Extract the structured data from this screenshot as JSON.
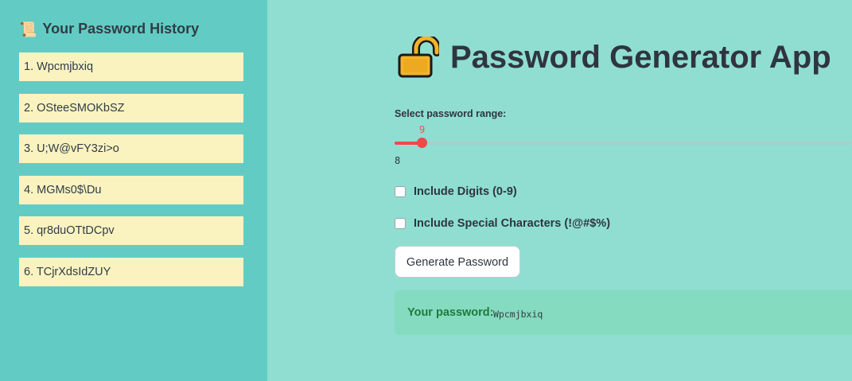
{
  "sidebar": {
    "title": "Your Password History",
    "title_icon": "scroll-icon",
    "history": [
      "1. Wpcmjbxiq",
      "2. OSteeSMOKbSZ",
      "3. U;W@vFY3zi>o",
      "4. MGMs0$\\Du",
      "5. qr8duOTtDCpv",
      "6. TCjrXdsIdZUY"
    ]
  },
  "main": {
    "title": "Password Generator App",
    "title_icon": "lock-icon",
    "slider": {
      "label": "Select password range:",
      "value": "9",
      "min": "8"
    },
    "checkboxes": [
      {
        "label": "Include Digits (0-9)",
        "checked": false
      },
      {
        "label": "Include Special Characters (!@#$%)",
        "checked": false
      }
    ],
    "generate_button": "Generate Password",
    "result": {
      "label": "Your password:",
      "value": "Wpcmjbxiq"
    }
  },
  "colors": {
    "sidebar_bg": "#62ccc4",
    "main_bg": "#8fded1",
    "history_item_bg": "#faf3c0",
    "slider_accent": "#f04848",
    "success_box_bg": "#85dbbf",
    "success_text": "#1e7a3c"
  }
}
